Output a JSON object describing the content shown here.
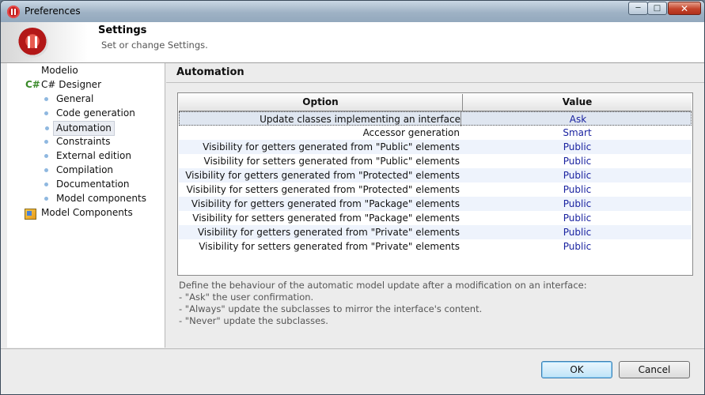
{
  "window": {
    "title": "Preferences"
  },
  "banner": {
    "title": "Settings",
    "subtitle": "Set or change Settings."
  },
  "nav": {
    "items": [
      {
        "label": "Modelio",
        "level": 0
      },
      {
        "label": "C# Designer",
        "level": 0,
        "icon": "csharp-icon"
      },
      {
        "label": "General",
        "level": 1
      },
      {
        "label": "Code generation",
        "level": 1
      },
      {
        "label": "Automation",
        "level": 1,
        "selected": true
      },
      {
        "label": "Constraints",
        "level": 1
      },
      {
        "label": "External edition",
        "level": 1
      },
      {
        "label": "Compilation",
        "level": 1
      },
      {
        "label": "Documentation",
        "level": 1
      },
      {
        "label": "Model components",
        "level": 1
      },
      {
        "label": "Model Components",
        "level": 0,
        "icon": "model-components-icon"
      }
    ]
  },
  "main": {
    "title": "Automation",
    "table": {
      "headers": {
        "option": "Option",
        "value": "Value"
      },
      "rows": [
        {
          "option": "Update classes implementing an interface",
          "value": "Ask"
        },
        {
          "option": "Accessor generation",
          "value": "Smart"
        },
        {
          "option": "Visibility for getters generated from \"Public\" elements",
          "value": "Public"
        },
        {
          "option": "Visibility for setters generated from \"Public\" elements",
          "value": "Public"
        },
        {
          "option": "Visibility for getters generated from \"Protected\" elements",
          "value": "Public"
        },
        {
          "option": "Visibility for setters generated from \"Protected\" elements",
          "value": "Public"
        },
        {
          "option": "Visibility for getters generated from \"Package\" elements",
          "value": "Public"
        },
        {
          "option": "Visibility for setters generated from \"Package\" elements",
          "value": "Public"
        },
        {
          "option": "Visibility for getters generated from \"Private\" elements",
          "value": "Public"
        },
        {
          "option": "Visibility for setters generated from \"Private\" elements",
          "value": "Public"
        }
      ]
    },
    "description": [
      "Define the behaviour of the automatic model update after a modification on an interface:",
      "- \"Ask\" the user confirmation.",
      "- \"Always\" update the subclasses to mirror the interface's content.",
      "- \"Never\" update the subclasses."
    ]
  },
  "buttons": {
    "ok": "OK",
    "cancel": "Cancel"
  },
  "colors": {
    "value_text": "#1a23a0",
    "alt_row": "#eef3fc",
    "ok_focus": "#3c7fb1"
  }
}
